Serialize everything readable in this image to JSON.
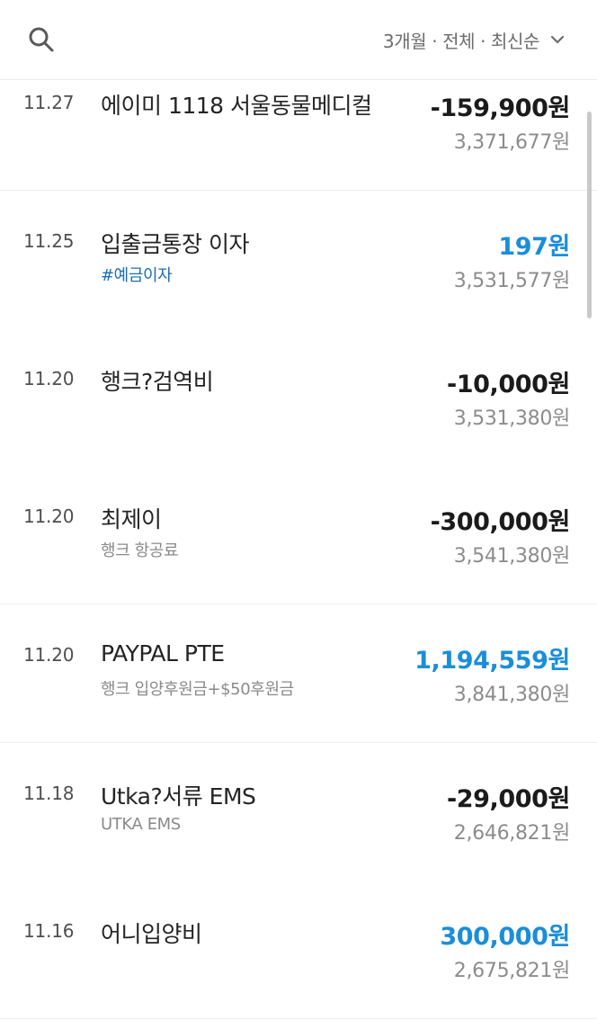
{
  "header": {
    "search_icon": "search-icon",
    "filter_label": "3개월 · 전체 · 최신순",
    "filter_icon": "chevron-down-icon"
  },
  "transactions": [
    {
      "date": "11.27",
      "title": "에이미 1118 서울동물메디컬",
      "memo": "",
      "amount": "-159,900원",
      "balance": "3,371,677원",
      "type": "withdrawal"
    },
    {
      "date": "11.25",
      "title": "입출금통장 이자",
      "memo": "#예금이자",
      "amount": "197원",
      "balance": "3,531,577원",
      "type": "deposit"
    },
    {
      "date": "11.20",
      "title": "행크?검역비",
      "memo": "",
      "amount": "-10,000원",
      "balance": "3,531,380원",
      "type": "withdrawal"
    },
    {
      "date": "11.20",
      "title": "최제이",
      "memo": "행크 항공료",
      "amount": "-300,000원",
      "balance": "3,541,380원",
      "type": "withdrawal"
    },
    {
      "date": "11.20",
      "title": "PAYPAL PTE",
      "memo": "행크 입양후원금+$50후원금",
      "amount": "1,194,559원",
      "balance": "3,841,380원",
      "type": "deposit"
    },
    {
      "date": "11.18",
      "title": "Utka?서류 EMS",
      "memo": "UTKA EMS",
      "amount": "-29,000원",
      "balance": "2,646,821원",
      "type": "withdrawal"
    },
    {
      "date": "11.16",
      "title": "어니입양비",
      "memo": "",
      "amount": "300,000원",
      "balance": "2,675,821원",
      "type": "deposit"
    }
  ],
  "colors": {
    "deposit": "#1b8ed8",
    "withdrawal": "#1b1b1b",
    "tag": "#1a6fb0"
  }
}
